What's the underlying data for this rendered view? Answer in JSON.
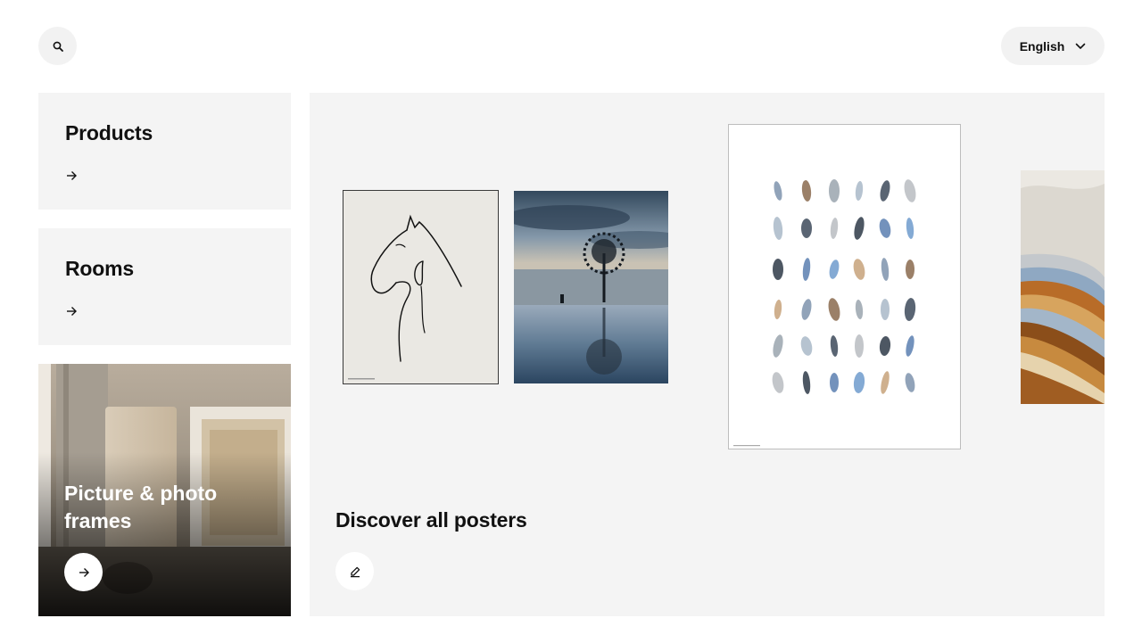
{
  "header": {
    "search_icon": "search-icon",
    "language_label": "English",
    "language_icon": "chevron-down-icon"
  },
  "tiles": [
    {
      "label": "Products",
      "icon": "arrow-right-icon"
    },
    {
      "label": "Rooms",
      "icon": "arrow-right-icon"
    }
  ],
  "frames_tile": {
    "label": "Picture & photo frames",
    "icon": "arrow-right-icon"
  },
  "posters_panel": {
    "label": "Discover all posters",
    "icon": "pencil-icon"
  },
  "colors": {
    "tile_bg": "#f4f4f4",
    "button_bg": "#f2f2f2",
    "text": "#111111"
  }
}
